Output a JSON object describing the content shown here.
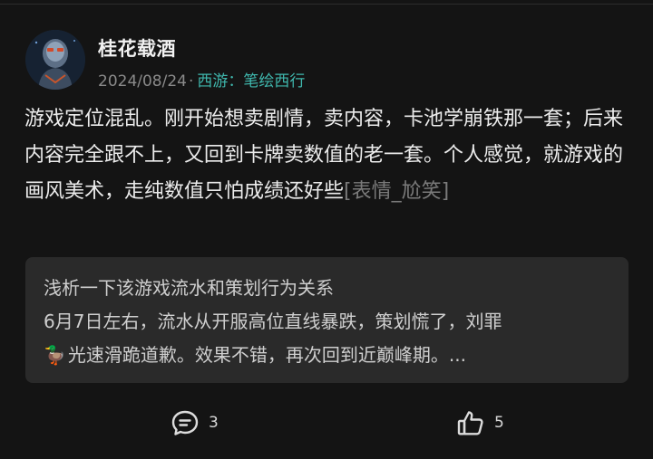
{
  "post": {
    "username": "桂花载酒",
    "date": "2024/08/24",
    "separator": "·",
    "tag": "西游：笔绘西行",
    "body_main": "游戏定位混乱。刚开始想卖剧情，卖内容，卡池学崩铁那一套；后来内容完全跟不上，又回到卡牌卖数值的老一套。个人感觉，就游戏的画风美术，走纯数值只怕成绩还好些",
    "body_emote": "[表情_尬笑]"
  },
  "quote": {
    "title": "浅析一下该游戏流水和策划行为关系",
    "line1": "6月7日左右，流水从开服高位直线暴跌，策划慌了，刘罪",
    "duck": "🦆",
    "line2": "光速滑跪道歉。效果不错，再次回到近巅峰期。..."
  },
  "actions": {
    "comment_count": "3",
    "like_count": "5",
    "comment_icon": "comment-bubble-icon",
    "like_icon": "thumbs-up-icon"
  },
  "colors": {
    "background": "#141414",
    "tag": "#3fb7ad",
    "quote_bg": "#2a2a2a",
    "meta": "#8a8a8a"
  }
}
